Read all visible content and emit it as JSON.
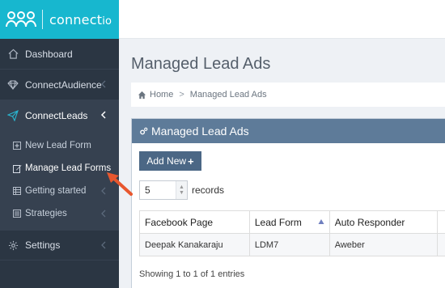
{
  "brand": {
    "name_bold": "connect",
    "name_light": "io"
  },
  "sidebar": {
    "items": [
      {
        "label": "Dashboard",
        "icon": "home-icon"
      },
      {
        "label": "ConnectAudience",
        "icon": "diamond-icon"
      },
      {
        "label": "ConnectLeads",
        "icon": "paper-plane-icon"
      },
      {
        "label": "Settings",
        "icon": "gear-icon"
      }
    ],
    "subitems": [
      {
        "label": "New Lead Form",
        "icon": "plus-square-icon"
      },
      {
        "label": "Manage Lead Forms",
        "icon": "edit-icon"
      },
      {
        "label": "Getting started",
        "icon": "table-icon"
      },
      {
        "label": "Strategies",
        "icon": "list-icon"
      }
    ]
  },
  "page": {
    "title": "Managed Lead Ads"
  },
  "breadcrumb": {
    "home": "Home",
    "separator": ">",
    "current": "Managed Lead Ads"
  },
  "portlet": {
    "title": "Managed Lead Ads",
    "add_button": "Add New",
    "add_button_plus": "+",
    "length_value": "5",
    "length_suffix": "records",
    "columns": [
      "Facebook Page",
      "Lead Form",
      "Auto Responder"
    ],
    "rows": [
      [
        "Deepak Kanakaraju",
        "LDM7",
        "Aweber"
      ]
    ],
    "info": "Showing 1 to 1 of 1 entries"
  },
  "colors": {
    "brand": "#17b7cf",
    "sidebar": "#2b3643",
    "portlet_head": "#5e7b99",
    "annotation": "#e8572e"
  }
}
